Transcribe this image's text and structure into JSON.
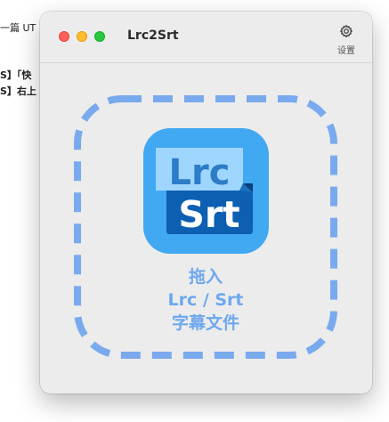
{
  "background_document": {
    "lines": [
      "一篇 UT",
      "S】「快",
      "S】右上"
    ]
  },
  "window": {
    "title": "Lrc2Srt",
    "settings_label": "设置"
  },
  "app_icon": {
    "top_text": "Lrc",
    "bottom_text": "Srt",
    "colors": {
      "background": "#41a8f2",
      "top_panel": "#9fd6ff",
      "top_text": "#2d7cc8",
      "bottom_panel": "#0d5fb2",
      "bottom_text": "#ffffff"
    }
  },
  "drop_zone": {
    "line1": "拖入",
    "line2": "Lrc / Srt",
    "line3": "字幕文件",
    "border_color": "#7aaaee",
    "text_color": "#6ea8ee"
  }
}
